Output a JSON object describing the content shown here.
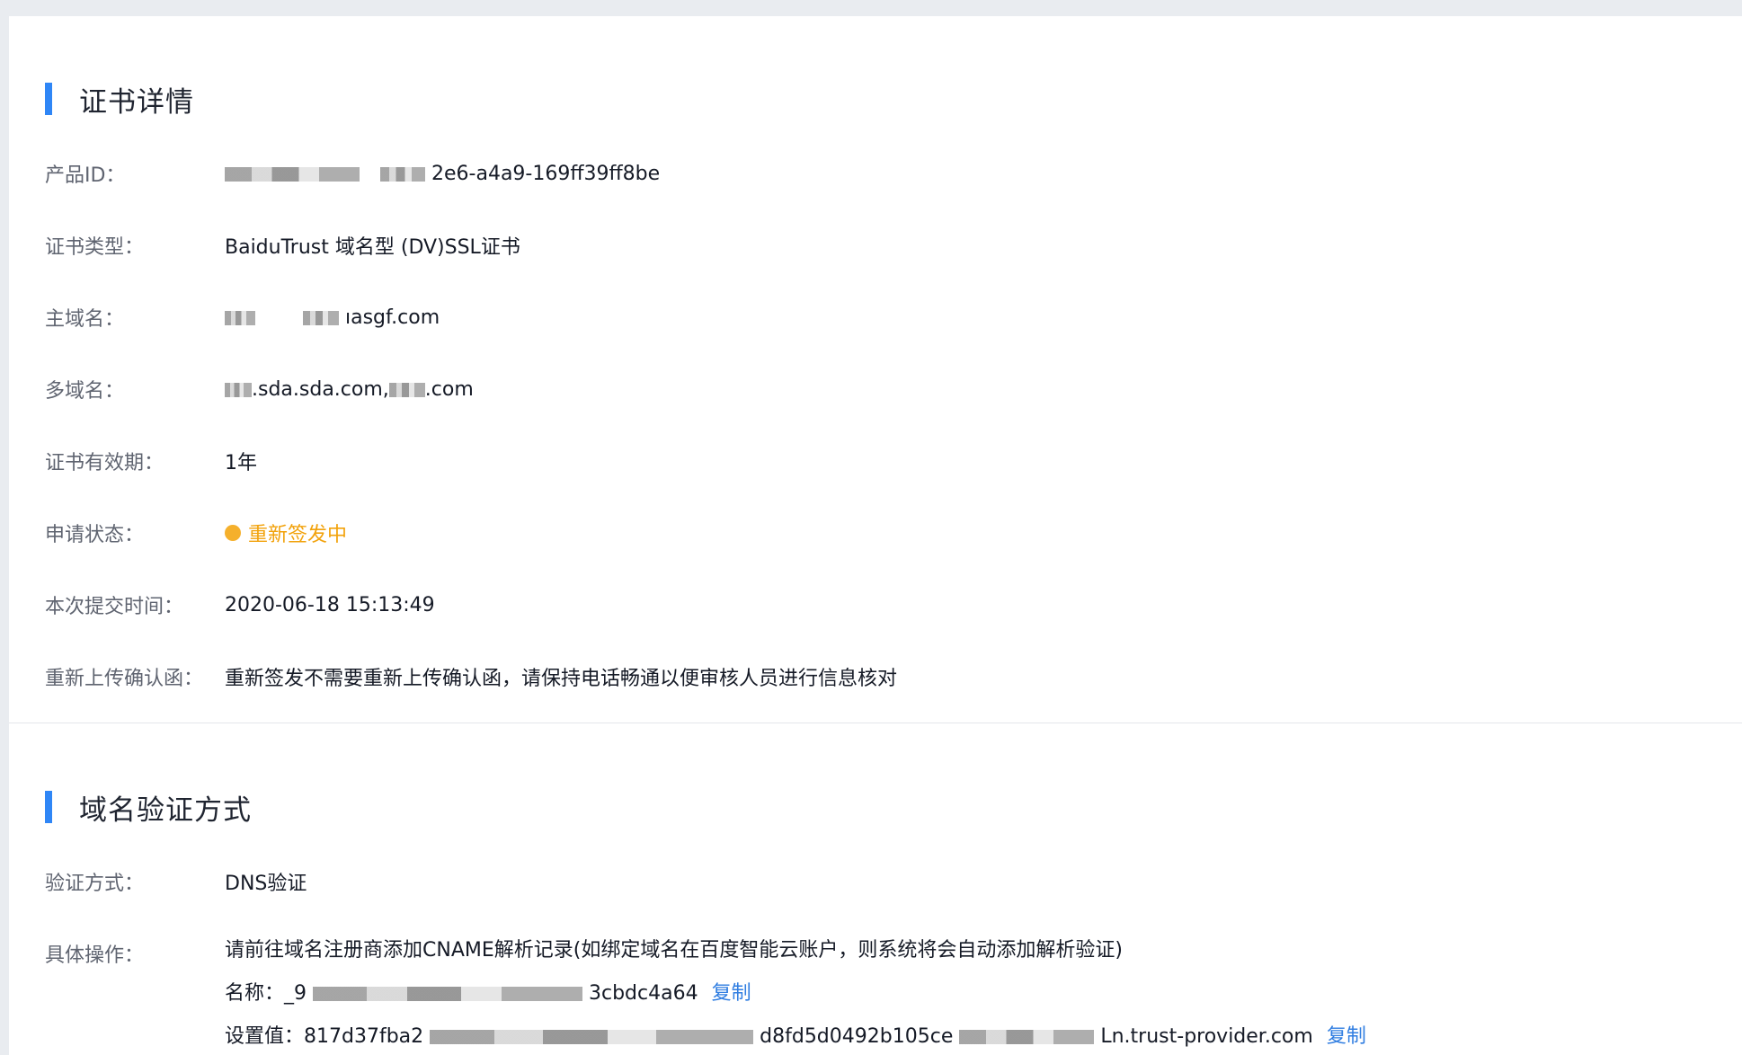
{
  "cert_section": {
    "title": "证书详情",
    "rows": [
      {
        "label": "产品ID：",
        "value": "2e6-a4a9-169ff39ff8be"
      },
      {
        "label": "证书类型：",
        "value": "BaiduTrust 域名型 (DV)SSL证书"
      },
      {
        "label": "主域名：",
        "value": "ıasgf.com"
      },
      {
        "label": "多域名：",
        "value": ".sda.sda.com,",
        "value2": ".com"
      },
      {
        "label": "证书有效期：",
        "value": "1年"
      },
      {
        "label": "申请状态：",
        "value": "重新签发中"
      },
      {
        "label": "本次提交时间：",
        "value": "2020-06-18 15:13:49"
      },
      {
        "label": "重新上传确认函：",
        "value": "重新签发不需要重新上传确认函，请保持电话畅通以便审核人员进行信息核对"
      }
    ]
  },
  "domain_section": {
    "title": "域名验证方式",
    "verify_label": "验证方式：",
    "verify_value": "DNS验证",
    "op_label": "具体操作：",
    "op_line1": "请前往域名注册商添加CNAME解析记录(如绑定域名在百度智能云账户，则系统将会自动添加解析验证)",
    "name_prefix": "名称：_9",
    "name_suffix": "3cbdc4a64",
    "value_prefix": "设置值：817d37fba2",
    "value_middle": "d8fd5d0492b105ce",
    "value_suffix": "Ln.trust-provider.com",
    "copy_label": "复制"
  },
  "colors": {
    "accent": "#2f86f6",
    "status": "#f2a20b",
    "link": "#2f7de1"
  }
}
